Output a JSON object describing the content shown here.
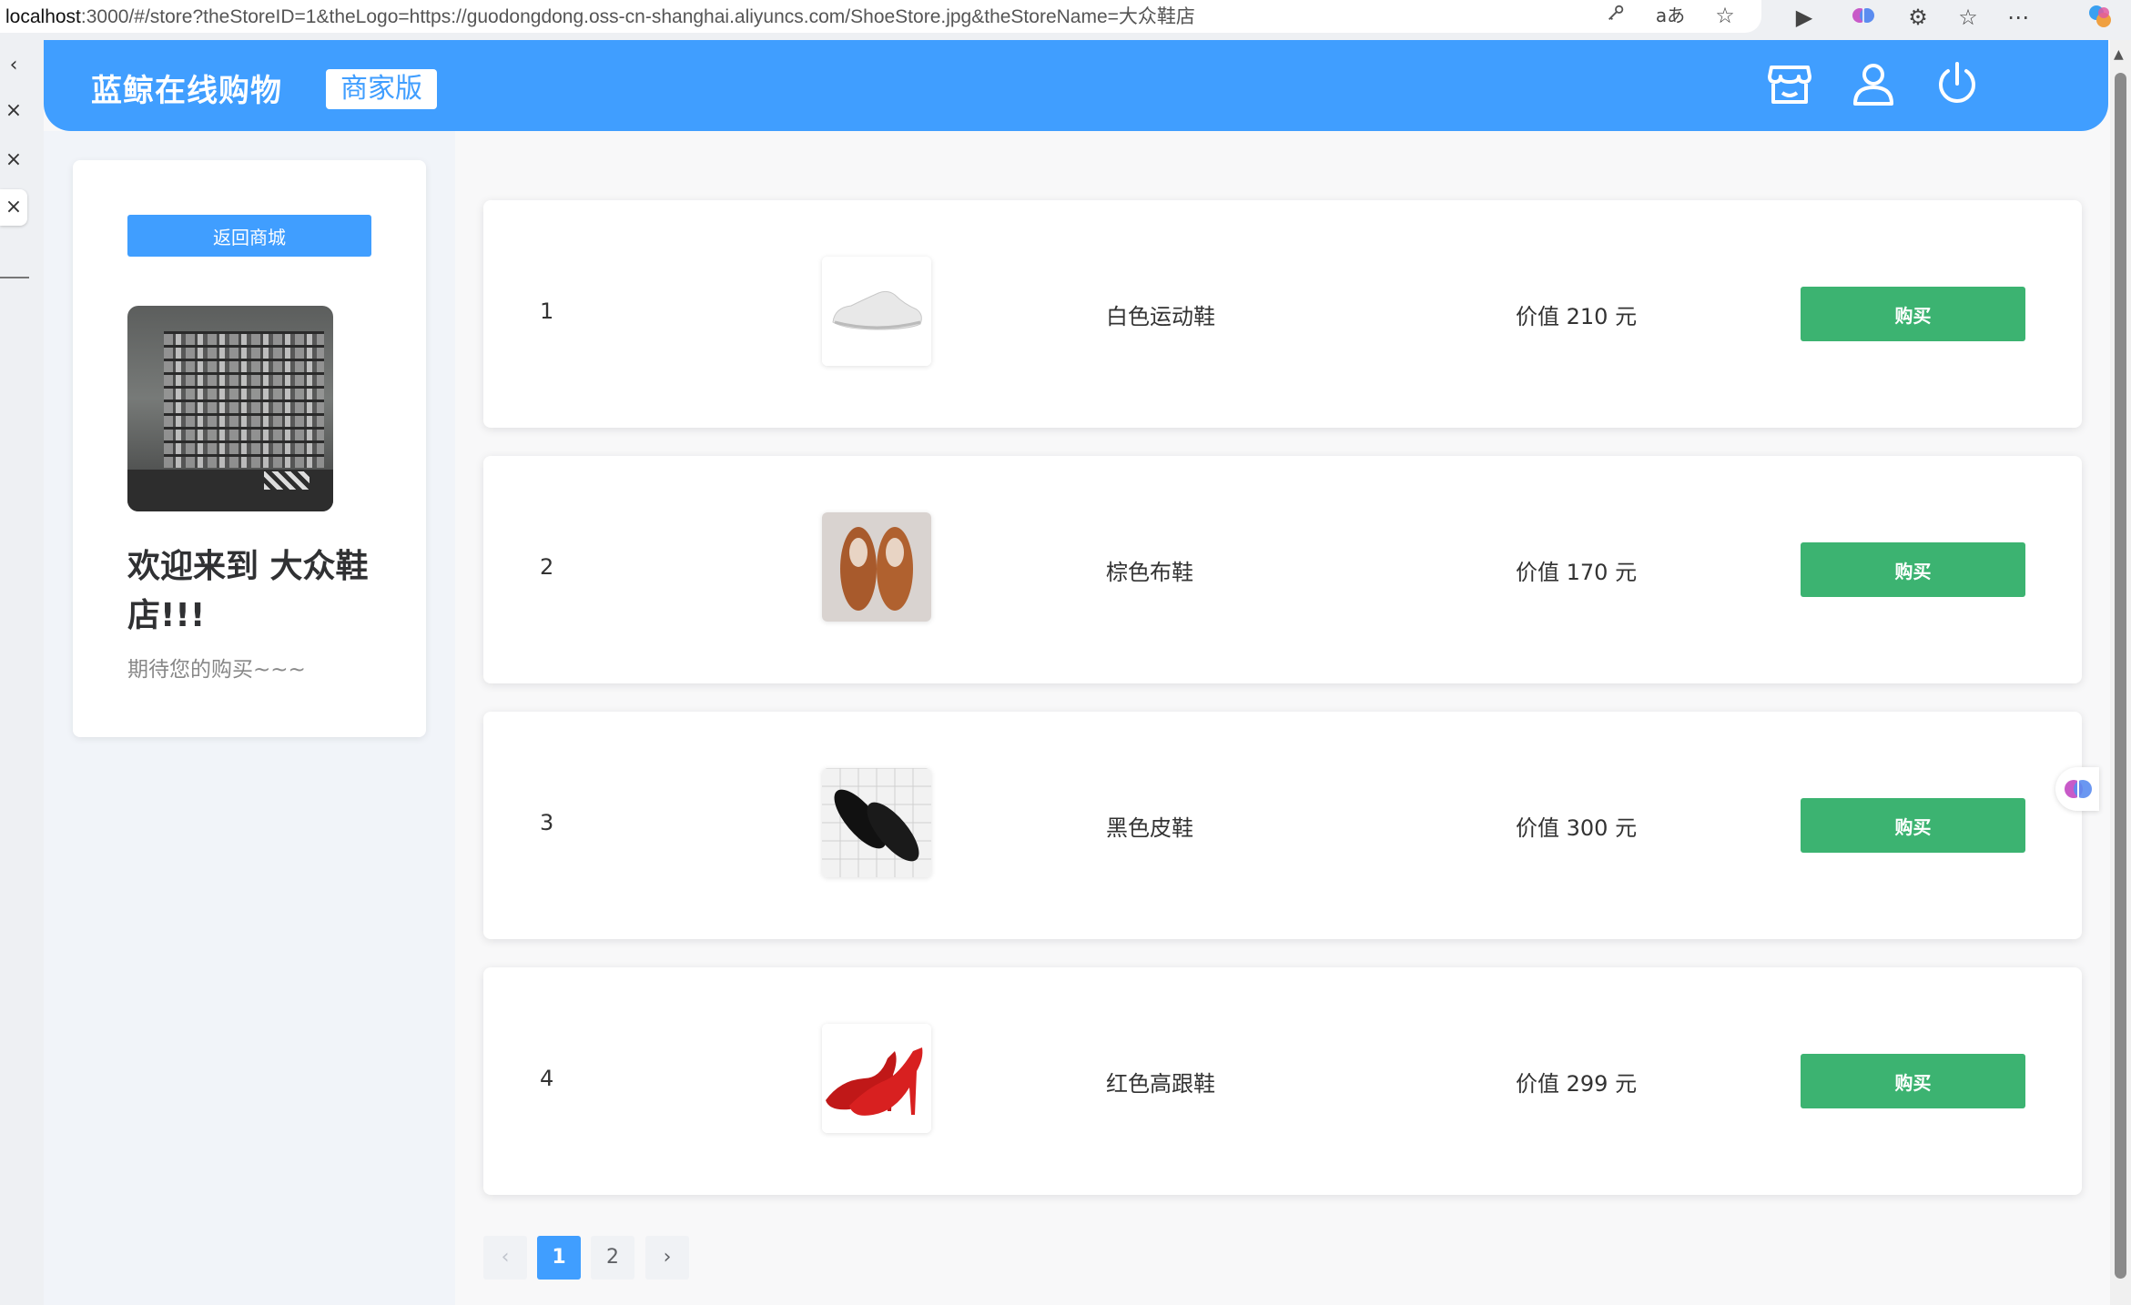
{
  "browser": {
    "url_host": "localhost",
    "url_rest": ":3000/#/store?theStoreID=1&theLogo=https://guodongdong.oss-cn-shanghai.aliyuncs.com/ShoeStore.jpg&theStoreName=大众鞋店"
  },
  "header": {
    "brand": "蓝鲸在线购物",
    "edition": "商家版"
  },
  "sidebar": {
    "back_button": "返回商城",
    "welcome": "欢迎来到 大众鞋店!!!",
    "slogan": "期待您的购买~~~"
  },
  "products": [
    {
      "index": "1",
      "name": "白色运动鞋",
      "price": "价值 210 元",
      "buy": "购买"
    },
    {
      "index": "2",
      "name": "棕色布鞋",
      "price": "价值 170 元",
      "buy": "购买"
    },
    {
      "index": "3",
      "name": "黑色皮鞋",
      "price": "价值 300 元",
      "buy": "购买"
    },
    {
      "index": "4",
      "name": "红色高跟鞋",
      "price": "价值 299 元",
      "buy": "购买"
    }
  ],
  "pagination": {
    "prev": "‹",
    "pages": [
      "1",
      "2"
    ],
    "current": "1",
    "next": "›"
  },
  "colors": {
    "primary": "#409eff",
    "buy": "#3cb371"
  }
}
